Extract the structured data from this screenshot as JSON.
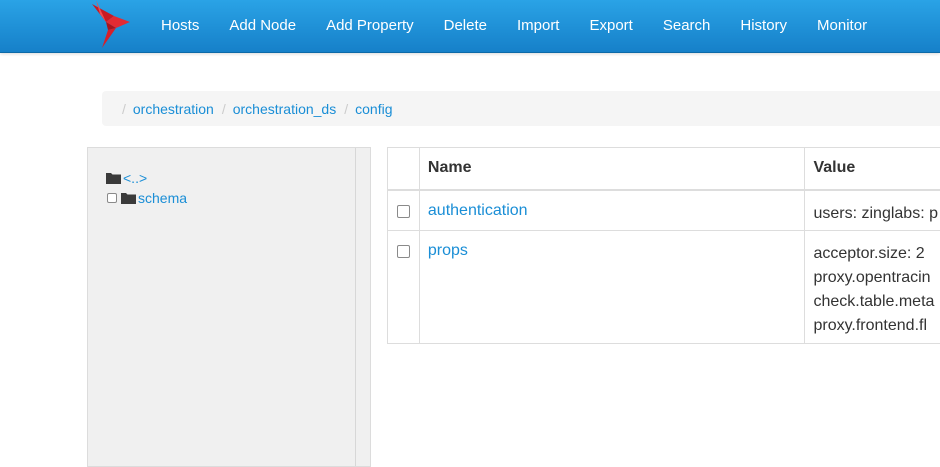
{
  "nav": {
    "items": [
      "Hosts",
      "Add Node",
      "Add Property",
      "Delete",
      "Import",
      "Export",
      "Search",
      "History",
      "Monitor"
    ]
  },
  "breadcrumb": {
    "items": [
      "orchestration",
      "orchestration_ds",
      "config"
    ]
  },
  "tree": {
    "parent_label": "<..>",
    "items": [
      {
        "label": "schema"
      }
    ]
  },
  "table": {
    "headers": {
      "name": "Name",
      "value": "Value"
    },
    "rows": [
      {
        "name": "authentication",
        "value_lines": [
          "users: zinglabs: p"
        ]
      },
      {
        "name": "props",
        "value_lines": [
          "acceptor.size: 2",
          "proxy.opentracin",
          "check.table.meta",
          "proxy.frontend.fl"
        ]
      }
    ]
  },
  "colors": {
    "navbar": "#1e8fd8",
    "link": "#1a8ed6",
    "brand_bird": "#d6202a"
  },
  "icons": {
    "brand": "bird-logo-icon",
    "folder": "folder-icon"
  }
}
